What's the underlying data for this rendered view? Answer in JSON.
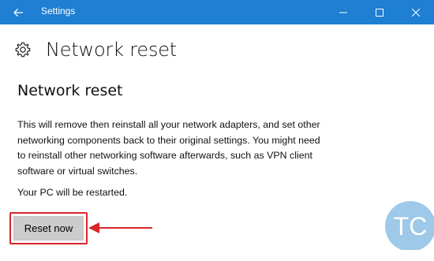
{
  "window": {
    "title": "Settings",
    "accent_color": "#1e7fd3",
    "controls": [
      "minimize-icon",
      "maximize-icon",
      "close-icon"
    ],
    "back_icon": "back-arrow-icon"
  },
  "page": {
    "icon": "gear-icon",
    "title": "Network reset"
  },
  "section": {
    "title": "Network reset",
    "description": "This will remove then reinstall all your network adapters, and set other networking components back to their original settings. You might need to reinstall other networking software afterwards, such as VPN client software or virtual switches.",
    "restart_note": "Your PC will be restarted."
  },
  "actions": {
    "reset_label": "Reset now"
  },
  "annotation": {
    "highlight_color": "#d9262a",
    "arrow": "red-arrow-left"
  },
  "watermark": {
    "text": "TC",
    "color": "#9ec9e8"
  }
}
